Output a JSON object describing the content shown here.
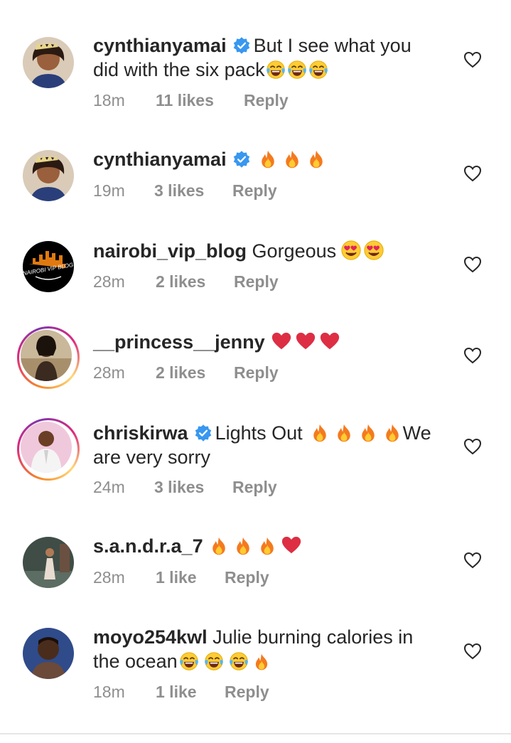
{
  "comments": [
    {
      "username": "cynthianyamai",
      "verified": true,
      "text_1": "But I see what you",
      "text_2": "did with the six pack",
      "time": "18m",
      "likes": "11 likes",
      "reply": "Reply"
    },
    {
      "username": "cynthianyamai",
      "verified": true,
      "text_1": "",
      "time": "19m",
      "likes": "3 likes",
      "reply": "Reply"
    },
    {
      "username": "nairobi_vip_blog",
      "verified": false,
      "text_1": "Gorgeous",
      "time": "28m",
      "likes": "2 likes",
      "reply": "Reply",
      "avatar_logo_text": "NAIROBI VIP BLOG"
    },
    {
      "username": "__princess__jenny",
      "verified": false,
      "text_1": "",
      "time": "28m",
      "likes": "2 likes",
      "reply": "Reply"
    },
    {
      "username": "chriskirwa",
      "verified": true,
      "text_1": "Lights Out",
      "text_1b": "We",
      "text_2": "are very sorry",
      "time": "24m",
      "likes": "3 likes",
      "reply": "Reply"
    },
    {
      "username": "s.a.n.d.r.a_7",
      "verified": false,
      "text_1": "",
      "time": "28m",
      "likes": "1 like",
      "reply": "Reply"
    },
    {
      "username": "moyo254kwl",
      "verified": false,
      "text_1": "Julie burning calories in",
      "text_2": "the ocean",
      "time": "18m",
      "likes": "1 like",
      "reply": "Reply"
    }
  ],
  "colors": {
    "text": "#262626",
    "meta": "#8e8e8e",
    "verified": "#3897f0",
    "heart_red": "#e0245e"
  },
  "icons": {
    "verified": "verified-badge-icon",
    "like": "heart-outline-icon",
    "laugh": "tears-of-joy-emoji",
    "fire": "fire-emoji",
    "heart_eyes": "heart-eyes-emoji",
    "red_heart": "red-heart-emoji"
  }
}
